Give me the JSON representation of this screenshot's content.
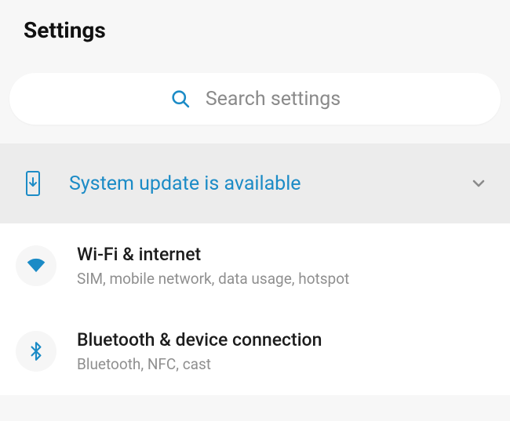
{
  "header": {
    "title": "Settings"
  },
  "search": {
    "placeholder": "Search settings"
  },
  "banner": {
    "text": "System update is available"
  },
  "items": [
    {
      "title": "Wi-Fi & internet",
      "subtitle": "SIM, mobile network, data usage, hotspot"
    },
    {
      "title": "Bluetooth & device connection",
      "subtitle": "Bluetooth, NFC, cast"
    }
  ],
  "colors": {
    "accent": "#1b8bc6",
    "bannerBg": "#ececec",
    "subtitle": "#8f8f8f"
  }
}
